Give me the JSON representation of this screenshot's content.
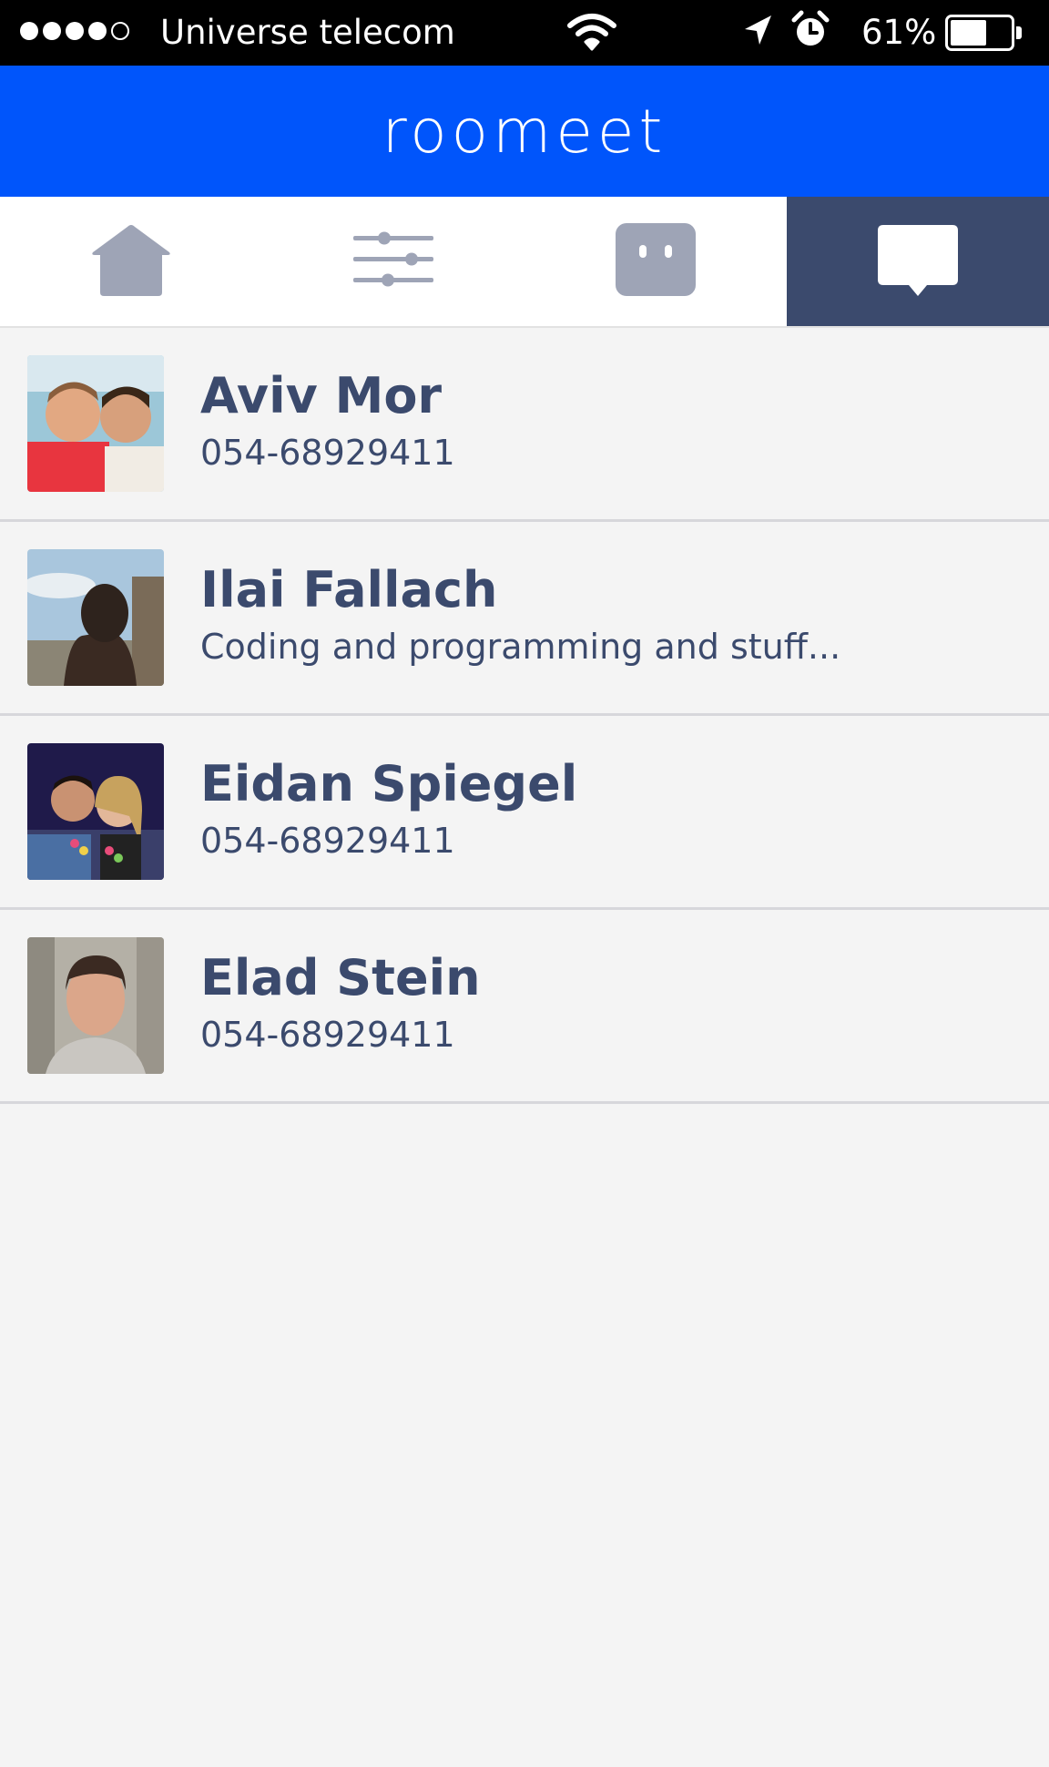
{
  "status_bar": {
    "signal_bars_filled": 4,
    "signal_bars_total": 5,
    "carrier": "Universe telecom",
    "icons": [
      "wifi-icon",
      "location-arrow-icon",
      "alarm-clock-icon"
    ],
    "battery_percent_label": "61%",
    "battery_level": 0.61
  },
  "header": {
    "logo_text": "roomeet",
    "background_color": "#0055fb"
  },
  "tabs": [
    {
      "icon": "home-icon",
      "active": false
    },
    {
      "icon": "filters-sliders-icon",
      "active": false
    },
    {
      "icon": "robot-face-icon",
      "active": false
    },
    {
      "icon": "chat-bubble-icon",
      "active": true
    }
  ],
  "contacts": [
    {
      "name": "Aviv Mor",
      "subtitle": "054-68929411"
    },
    {
      "name": "Ilai Fallach",
      "subtitle": "Coding and programming and stuff..."
    },
    {
      "name": "Eidan Spiegel",
      "subtitle": "054-68929411"
    },
    {
      "name": "Elad Stein",
      "subtitle": "054-68929411"
    }
  ],
  "colors": {
    "text_primary": "#3b4a6d",
    "tab_inactive_icon": "#9ea4b6",
    "tab_active_bg": "#3b4a6d",
    "list_bg": "#f4f4f4"
  }
}
